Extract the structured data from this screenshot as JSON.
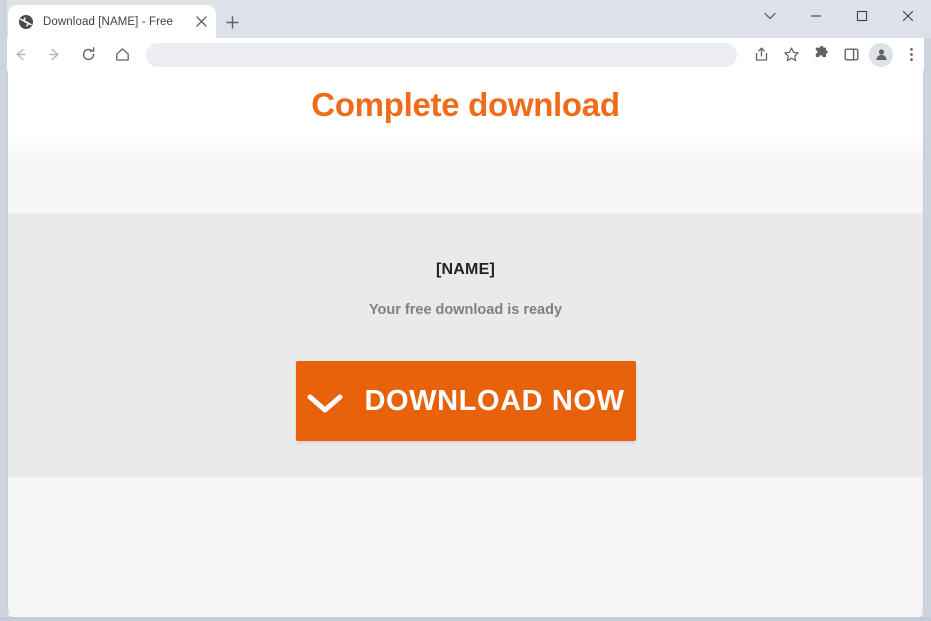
{
  "window": {
    "controls": {
      "tab_search_label": "chevron-down",
      "minimize_label": "—",
      "maximize_label": "☐",
      "close_label": "✕"
    }
  },
  "tabstrip": {
    "tabs": [
      {
        "title": "Download [NAME] - Free",
        "favicon": "globe-icon",
        "close_label": "✕",
        "active": true
      }
    ],
    "new_tab_label": "+"
  },
  "toolbar": {
    "back_label": "back-icon",
    "forward_label": "forward-icon",
    "reload_label": "reload-icon",
    "home_label": "home-icon",
    "omnibox": {
      "value": "",
      "placeholder": ""
    },
    "share_label": "share-icon",
    "bookmark_label": "star-icon",
    "extensions_label": "puzzle-icon",
    "side_panel_label": "side-panel-icon",
    "profile_label": "profile-avatar-icon",
    "menu_label": "three-dot-menu-icon"
  },
  "page": {
    "heading": "Complete download",
    "heading_color": "#ef6c1a",
    "product_name": "[NAME]",
    "ready_text": "Your free download is ready",
    "download_button": {
      "label": "DOWNLOAD NOW",
      "icon": "chevron-down-icon",
      "color": "#e8620c",
      "text_color": "#ffffff"
    },
    "panel_background": "#eaeaea",
    "page_background": "#f6f6f6"
  }
}
